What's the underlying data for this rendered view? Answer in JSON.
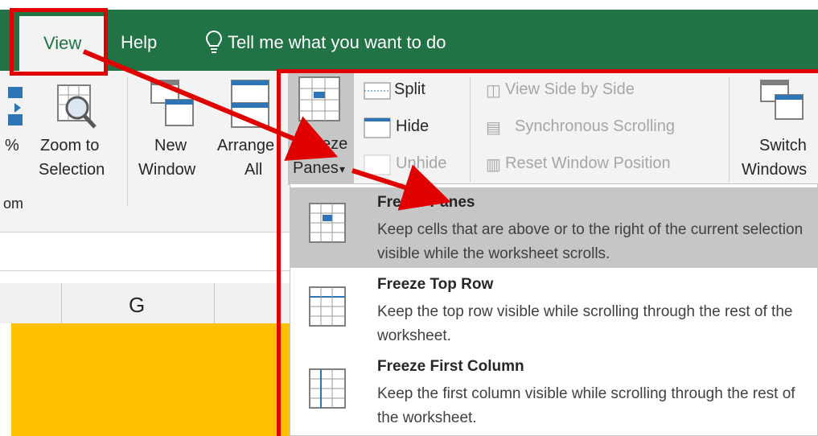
{
  "tabs": {
    "view": "View",
    "help": "Help",
    "tell_me": "Tell me what you want to do"
  },
  "ribbon": {
    "zoom_pct_fragment": "%",
    "zoom_to_selection_line1": "Zoom to",
    "zoom_to_selection_line2": "Selection",
    "zoom_group_fragment": "om",
    "new_window_line1": "New",
    "new_window_line2": "Window",
    "arrange_all_line1": "Arrange",
    "arrange_all_line2": "All",
    "freeze_panes_line1": "Freeze",
    "freeze_panes_line2": "Panes",
    "split": "Split",
    "hide": "Hide",
    "unhide": "Unhide",
    "view_side_by_side": "View Side by Side",
    "synchronous_scrolling": "Synchronous Scrolling",
    "reset_window_position": "Reset Window Position",
    "switch_windows_line1": "Switch",
    "switch_windows_line2": "Windows"
  },
  "sheet": {
    "column_g": "G"
  },
  "menu": {
    "items": [
      {
        "title": "Freeze Panes",
        "description": "Keep cells that are above or to the right of the current selection visible while the worksheet scrolls."
      },
      {
        "title": "Freeze Top Row",
        "description": "Keep the top row visible while scrolling through the rest of the worksheet."
      },
      {
        "title": "Freeze First Column",
        "description": "Keep the first column visible while scrolling through the rest of the worksheet."
      }
    ]
  },
  "colors": {
    "excel_green": "#217346",
    "ribbon_bg": "#f3f3f3",
    "highlight": "#c6c6c6",
    "annotation_red": "#e00000",
    "sheet_fill": "#ffc000"
  }
}
